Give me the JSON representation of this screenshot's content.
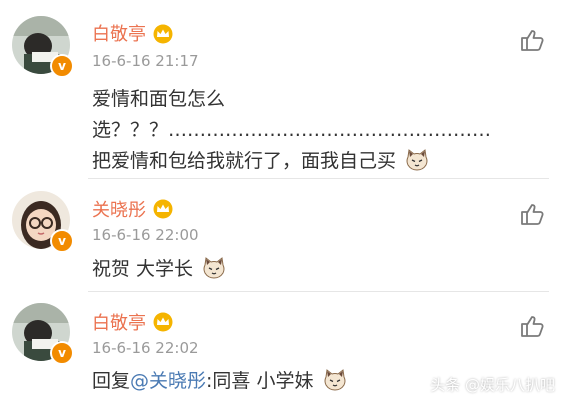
{
  "comments": [
    {
      "user": "白敬亭",
      "time": "16-6-16 21:17",
      "lines": [
        "爱情和面包怎么",
        "选？？？……………………………………………",
        "把爱情和包给我就行了，面我自己买"
      ],
      "badge": "v"
    },
    {
      "user": "关晓彤",
      "time": "16-6-16 22:00",
      "lines": [
        "祝贺 大学长"
      ],
      "badge": "v"
    },
    {
      "user": "白敬亭",
      "time": "16-6-16 22:02",
      "reply_prefix": "回复",
      "reply_to": "@关晓彤",
      "reply_text": ":同喜 小学妹",
      "badge": "v"
    }
  ],
  "watermark": "头条 @娱乐八扒吧",
  "icons": {
    "like": "thumbs-up-icon",
    "crown": "crown-icon",
    "emoji": "cat-face-emoji-icon"
  },
  "colors": {
    "username": "#eb7350",
    "timestamp": "#9a9a9a",
    "body": "#333333",
    "mention": "#4a7ab3",
    "verified_badge": "#f28b00"
  }
}
